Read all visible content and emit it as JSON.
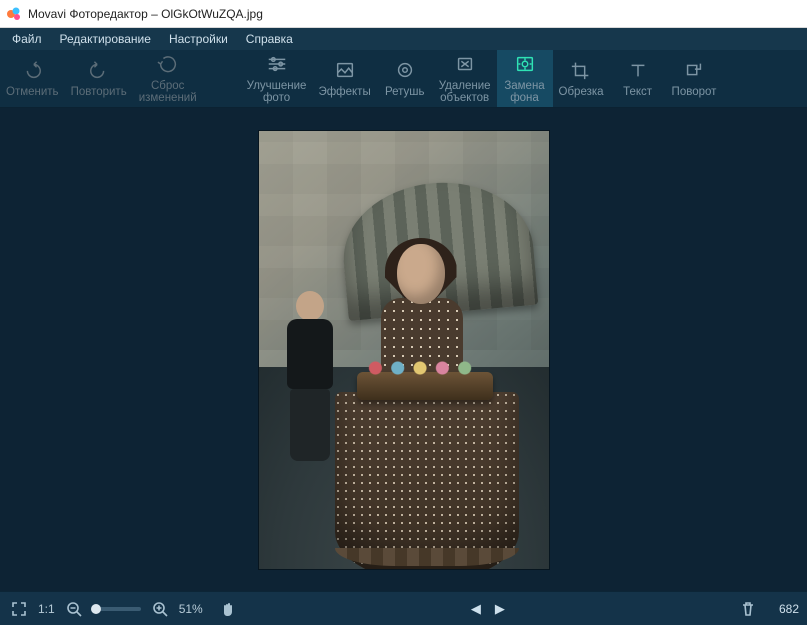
{
  "title": "Movavi Фоторедактор – OlGkOtWuZQA.jpg",
  "menu": {
    "file": "Файл",
    "edit": "Редактирование",
    "settings": "Настройки",
    "help": "Справка"
  },
  "toolbar": {
    "undo": "Отменить",
    "redo": "Повторить",
    "reset": "Сброс\nизменений",
    "enhance": "Улучшение\nфото",
    "effects": "Эффекты",
    "retouch": "Ретушь",
    "removal": "Удаление\nобъектов",
    "bg_replace": "Замена\nфона",
    "crop": "Обрезка",
    "text": "Текст",
    "rotate": "Поворот"
  },
  "bottom": {
    "scale_label": "1:1",
    "zoom_percent": "51%",
    "dimension": "682"
  }
}
